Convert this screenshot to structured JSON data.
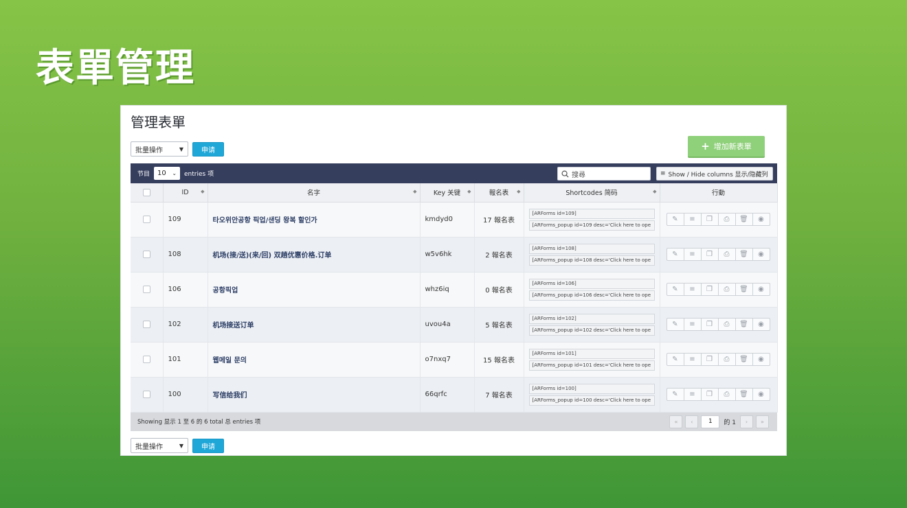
{
  "slide_title": "表單管理",
  "panel_title": "管理表單",
  "bulk": {
    "select_label": "批量操作",
    "apply_label": "申请"
  },
  "add_button_label": "增加新表單",
  "toolbar": {
    "show_label": "节目",
    "page_length": "10",
    "entries_label": "entries 项",
    "search_placeholder": "搜尋",
    "columns_button_label": "Show / Hide columns 显示/隐藏列"
  },
  "columns": [
    "ID",
    "名字",
    "Key 关键",
    "報名表",
    "Shortcodes 简码",
    "行動"
  ],
  "rows": [
    {
      "id": "109",
      "name": "타오위안공항 픽업/샌딩 왕복 할인가",
      "key": "kmdyd0",
      "entries": "17 報名表",
      "sc1": "[ARForms id=109]",
      "sc2": "[ARForms_popup id=109 desc='Click here to ope"
    },
    {
      "id": "108",
      "name": "机场(接/送)(来/回) 双趟优惠价格.订单",
      "key": "w5v6hk",
      "entries": "2 報名表",
      "sc1": "[ARForms id=108]",
      "sc2": "[ARForms_popup id=108 desc='Click here to ope"
    },
    {
      "id": "106",
      "name": "공항픽업",
      "key": "whz6iq",
      "entries": "0 報名表",
      "sc1": "[ARForms id=106]",
      "sc2": "[ARForms_popup id=106 desc='Click here to ope"
    },
    {
      "id": "102",
      "name": "机场接送订单",
      "key": "uvou4a",
      "entries": "5 報名表",
      "sc1": "[ARForms id=102]",
      "sc2": "[ARForms_popup id=102 desc='Click here to ope"
    },
    {
      "id": "101",
      "name": "웹메일 문의",
      "key": "o7nxq7",
      "entries": "15 報名表",
      "sc1": "[ARForms id=101]",
      "sc2": "[ARForms_popup id=101 desc='Click here to ope"
    },
    {
      "id": "100",
      "name": "写信给我们",
      "key": "66qrfc",
      "entries": "7 報名表",
      "sc1": "[ARForms id=100]",
      "sc2": "[ARForms_popup id=100 desc='Click here to ope"
    }
  ],
  "footer": {
    "showing_text": "Showing 显示 1 至 6 的 6 total 总 entries 项",
    "current_page": "1",
    "of_label": "的 1"
  },
  "icons": [
    "edit-icon",
    "entries-list-icon",
    "duplicate-icon",
    "export-icon",
    "delete-icon",
    "preview-icon"
  ]
}
